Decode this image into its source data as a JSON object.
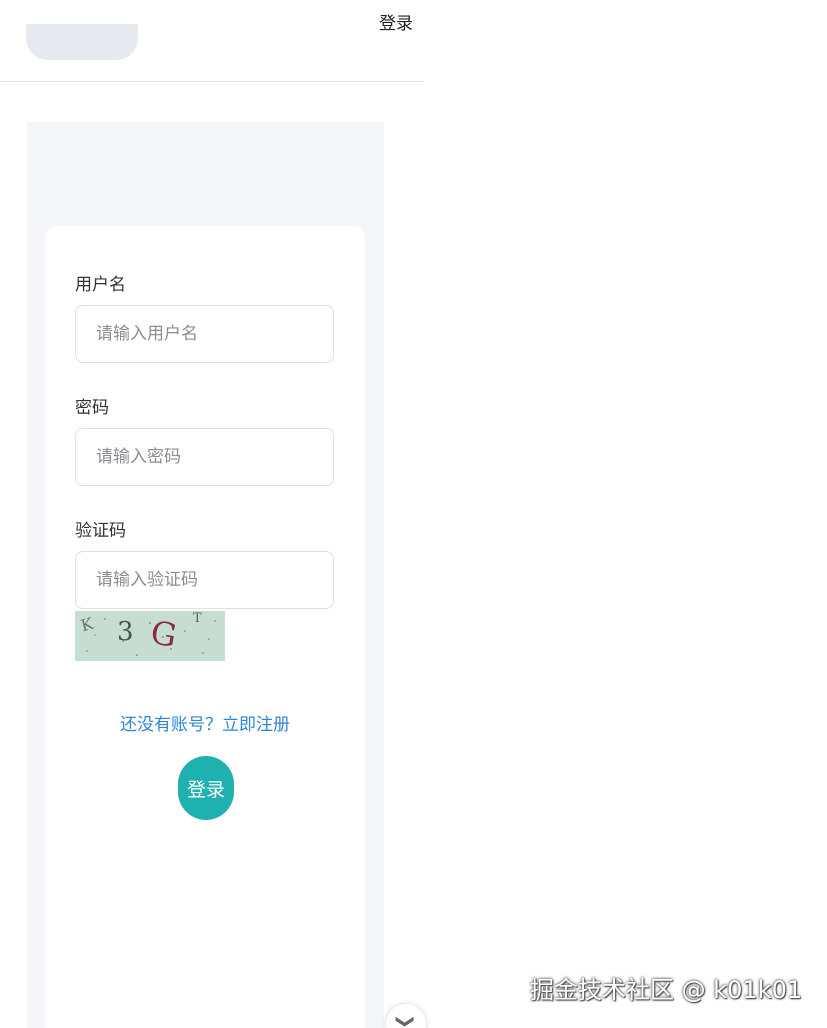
{
  "header": {
    "login_label": "登录"
  },
  "form": {
    "username": {
      "label": "用户名",
      "placeholder": "请输入用户名"
    },
    "password": {
      "label": "密码",
      "placeholder": "请输入密码"
    },
    "captcha": {
      "label": "验证码",
      "placeholder": "请输入验证码",
      "image_text": [
        "K",
        "3",
        "G",
        "T"
      ]
    },
    "register_link": "还没有账号？立即注册",
    "submit_label": "登录"
  },
  "watermark": "掘金技术社区 @ k01k01",
  "icons": {
    "scroll": "chevron-down-icon"
  },
  "colors": {
    "accent": "#1fb0b0",
    "link": "#2f86d8",
    "panel_bg": "#f4f6f9"
  }
}
